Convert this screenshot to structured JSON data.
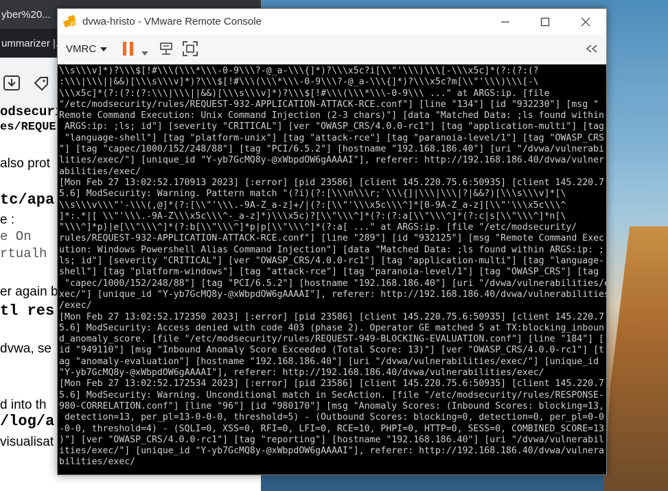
{
  "background": {
    "tab_title_1": "yber%20...",
    "tab_title_2": "ummarizer |...",
    "doc_lines": [
      "odsecuri",
      "es/REQUE",
      "also prot",
      "tc/apa",
      "e :",
      "e On",
      "rtualh",
      "er again b",
      "tl res",
      "dvwa, se",
      "d into th",
      "/log/a",
      "visualisat"
    ]
  },
  "window": {
    "title": "dvwa-hristo - VMware Remote Console",
    "vmrc_label": "VMRC",
    "pause_color": "#f26c21"
  },
  "terminal": {
    "lines": [
      "\\\\s\\\\\\v]*)?\\\\\\$[!#\\\\\\(\\\\\\*\\\\\\-0-9\\\\\\?-@_a-\\\\\\{]*)?\\\\\\x5c?i[\\\\\"'\\\\\\)\\\\\\[-\\\\\\x5c]*(?:(?:(?",
      ":\\\\\\|\\\\\\||&&)[\\\\\\s\\\\\\v]*)?\\\\\\$[!#\\\\\\(\\\\\\*\\\\\\-0-9\\\\\\?-@_a-\\\\\\{]*)?\\\\\\x5c?m[\\\\\"'\\\\\\)\\\\\\[-\\",
      "\\\\\\x5c]*(?:(?:(?:\\\\\\|\\\\\\||&&)[\\\\\\s\\\\\\v]*)?\\\\\\$[!#\\\\\\(\\\\\\*\\\\\\-0-9\\\\\\ ...\" at ARGS:ip. [file",
      "\"/etc/modsecurity/rules/REQUEST-932-APPLICATION-ATTACK-RCE.conf\"] [line \"134\"] [id \"932230\"] [msg \"",
      "Remote Command Execution: Unix Command Injection (2-3 chars)\"] [data \"Matched Data: ;ls found within",
      " ARGS:ip: ;ls; id\"] [severity \"CRITICAL\"] [ver \"OWASP_CRS/4.0.0-rc1\"] [tag \"application-multi\"] [tag",
      " \"language-shell\"] [tag \"platform-unix\"] [tag \"attack-rce\"] [tag \"paranoia-level/1\"] [tag \"OWASP_CRS",
      "\"] [tag \"capec/1000/152/248/88\"] [tag \"PCI/6.5.2\"] [hostname \"192.168.186.40\"] [uri \"/dvwa/vulnerabi",
      "lities/exec/\"] [unique_id \"Y-yb7GcMQ8y-@xWbpdOW6gAAAAI\"], referer: http://192.168.186.40/dvwa/vulner",
      "abilities/exec/",
      "[Mon Feb 27 13:02:52.170913 2023] [:error] [pid 23586] [client 145.220.75.6:50935] [client 145.220.7",
      "5.6] ModSecurity: Warning. Pattern match \"(?i)(?:[\\\\\\n\\\\\\r;`\\\\\\{]|\\\\\\|\\\\\\|?|&&?)[\\\\\\s\\\\\\v]*[\\",
      "\\\\s\\\\\\v\\\\\\\"'-\\\\\\(,@]*(?:[\\\\\"'\\\\\\.-9A-Z_a-z]+/|(?:[\\\\\"'\\\\\\x5c\\\\\\^]*[0-9A-Z_a-z][\\\\\"'\\\\\\x5c\\\\\\^",
      "]*:.*|[ \\\\\"'\\\\\\.-9A-Z\\\\\\x5c\\\\\\^-_a-z]*)\\\\\\x5c)?[\\\\\"\\\\\\^]*(?:(?:a[\\\\\"\\\\\\^]*(?:c|s[\\\\\"\\\\\\^]*n[\\",
      "\"\\\\\\^]*p)|e[\\\\\"\\\\\\^]*(?:b[\\\\\"\\\\\\^]*p|p[\\\\\"\\\\\\^]*(?:a[ ...\" at ARGS:ip. [file \"/etc/modsecurity/",
      "rules/REQUEST-932-APPLICATION-ATTACK-RCE.conf\"] [line \"289\"] [id \"932125\"] [msg \"Remote Command Exec",
      "ution: Windows Powershell Alias Command Injection\"] [data \"Matched Data: ;ls found within ARGS:ip: ;",
      "ls; id\"] [severity \"CRITICAL\"] [ver \"OWASP_CRS/4.0.0-rc1\"] [tag \"application-multi\"] [tag \"language-",
      "shell\"] [tag \"platform-windows\"] [tag \"attack-rce\"] [tag \"paranoia-level/1\"] [tag \"OWASP_CRS\"] [tag",
      " \"capec/1000/152/248/88\"] [tag \"PCI/6.5.2\"] [hostname \"192.168.186.40\"] [uri \"/dvwa/vulnerabilities/e",
      "xec/\"] [unique_id \"Y-yb7GcMQ8y-@xWbpdOW6gAAAAI\"], referer: http://192.168.186.40/dvwa/vulnerabilities",
      "/exec/",
      "[Mon Feb 27 13:02:52.172350 2023] [:error] [pid 23586] [client 145.220.75.6:50935] [client 145.220.7",
      "5.6] ModSecurity: Access denied with code 403 (phase 2). Operator GE matched 5 at TX:blocking_inboun",
      "d_anomaly_score. [file \"/etc/modsecurity/rules/REQUEST-949-BLOCKING-EVALUATION.conf\"] [line \"184\"] [",
      "id \"949110\"] [msg \"Inbound Anomaly Score Exceeded (Total Score: 13)\"] [ver \"OWASP_CRS/4.0.0-rc1\"] [t",
      "ag \"anomaly-evaluation\"] [hostname \"192.168.186.40\"] [uri \"/dvwa/vulnerabilities/exec/\"] [unique_id",
      "\"Y-yb7GcMQ8y-@xWbpdOW6gAAAAI\"], referer: http://192.168.186.40/dvwa/vulnerabilities/exec/",
      "[Mon Feb 27 13:02:52.172534 2023] [:error] [pid 23586] [client 145.220.75.6:50935] [client 145.220.7",
      "5.6] ModSecurity: Warning. Unconditional match in SecAction. [file \"/etc/modsecurity/rules/RESPONSE-",
      "980-CORRELATION.conf\"] [line \"96\"] [id \"980170\"] [msg \"Anomaly Scores: (Inbound Scores: blocking=13,",
      " detection=13, per_pl=13-0-0-0, threshold=5) - (Outbound Scores: blocking=0, detection=0, per_pl=0-0",
      "-0-0, threshold=4) - (SQLI=0, XSS=0, RFI=0, LFI=0, RCE=10, PHPI=0, HTTP=0, SESS=0, COMBINED_SCORE=13",
      ")\"] [ver \"OWASP_CRS/4.0.0-rc1\"] [tag \"reporting\"] [hostname \"192.168.186.40\"] [uri \"/dvwa/vulnerabil",
      "ities/exec/\"] [unique_id \"Y-yb7GcMQ8y-@xWbpdOW6gAAAAI\"], referer: http://192.168.186.40/dvwa/vulnera",
      "bilities/exec/"
    ]
  }
}
